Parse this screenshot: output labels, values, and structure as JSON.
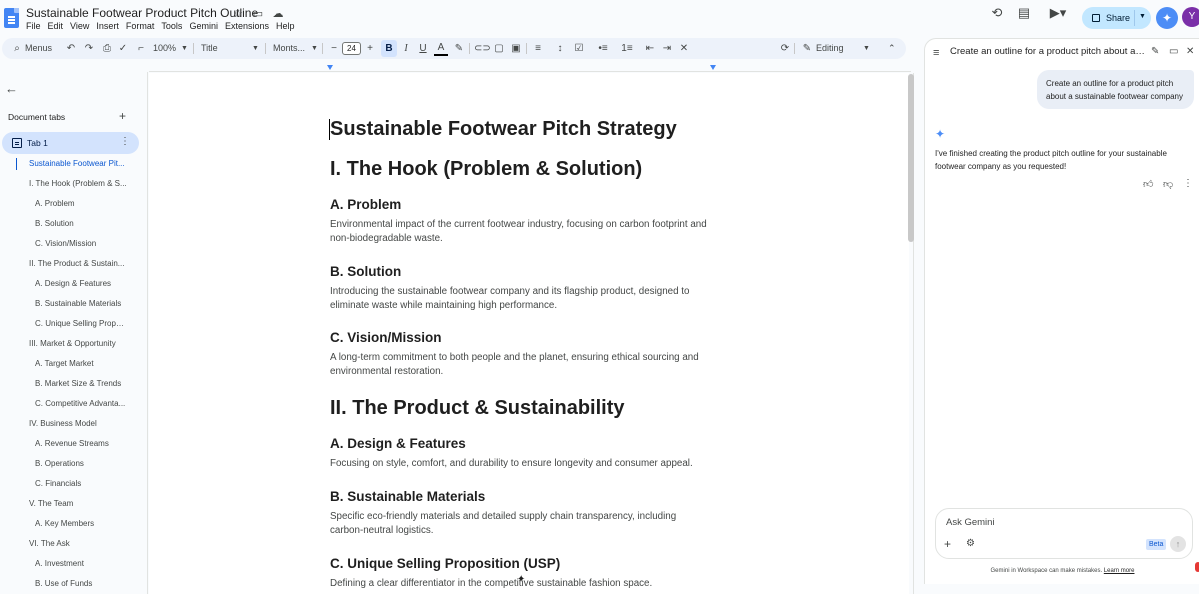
{
  "app": {
    "doc_title": "Sustainable Footwear Product Pitch Outline",
    "menu": [
      "File",
      "Edit",
      "View",
      "Insert",
      "Format",
      "Tools",
      "Gemini",
      "Extensions",
      "Help"
    ],
    "share_label": "Share",
    "avatar_letter": "Y"
  },
  "toolbar": {
    "menus_label": "Menus",
    "zoom": "100%",
    "style": "Title",
    "font": "Monts...",
    "font_size": "24",
    "bold": "B",
    "italic": "I",
    "underline": "U",
    "text_color": "A",
    "mode": "Editing"
  },
  "sidebar": {
    "tabs_heading": "Document tabs",
    "tab1_label": "Tab 1",
    "outline": [
      "Sustainable Footwear Pit...",
      "I. The Hook (Problem & S...",
      "A. Problem",
      "B. Solution",
      "C. Vision/Mission",
      "II. The Product & Sustain...",
      "A. Design & Features",
      "B. Sustainable Materials",
      "C. Unique Selling Propo...",
      "III. Market & Opportunity",
      "A. Target Market",
      "B. Market Size & Trends",
      "C. Competitive Advanta...",
      "IV. Business Model",
      "A. Revenue Streams",
      "B. Operations",
      "C. Financials",
      "V. The Team",
      "A. Key Members",
      "VI. The Ask",
      "A. Investment",
      "B. Use of Funds"
    ]
  },
  "document": {
    "title": "Sustainable Footwear Pitch Strategy",
    "h1_hook": "I. The Hook (Problem & Solution)",
    "h2_problem": "A. Problem",
    "p_problem": "Environmental impact of the current footwear industry, focusing on carbon footprint and non-biodegradable waste.",
    "h2_solution": "B. Solution",
    "p_solution": "Introducing the sustainable footwear company and its flagship product, designed to eliminate waste while maintaining high performance.",
    "h2_vision": "C. Vision/Mission",
    "p_vision": "A long-term commitment to both people and the planet, ensuring ethical sourcing and environmental restoration.",
    "h1_product": "II. The Product & Sustainability",
    "h2_design": "A. Design & Features",
    "p_design": "Focusing on style, comfort, and durability to ensure longevity and consumer appeal.",
    "h2_materials": "B. Sustainable Materials",
    "p_materials": "Specific eco-friendly materials and detailed supply chain transparency, including carbon-neutral logistics.",
    "h2_usp": "C. Unique Selling Proposition (USP)",
    "p_usp": "Defining a clear differentiator in the competitive sustainable fashion space."
  },
  "gemini": {
    "header_title": "Create an outline for a product pitch about a ...",
    "user_prompt": "Create an outline for a product pitch about a sustainable footwear company",
    "reply": "I've finished creating the product pitch outline for your sustainable footwear company as you requested!",
    "ask_placeholder": "Ask Gemini",
    "beta": "Beta",
    "disclaimer": "Gemini in Workspace can make mistakes.",
    "learn_more": "Learn more"
  },
  "colors": {
    "accent": "#0b57d0",
    "share_bg": "#c2e7ff",
    "active_tab": "#d3e3fd",
    "avatar": "#7a2fa8"
  }
}
